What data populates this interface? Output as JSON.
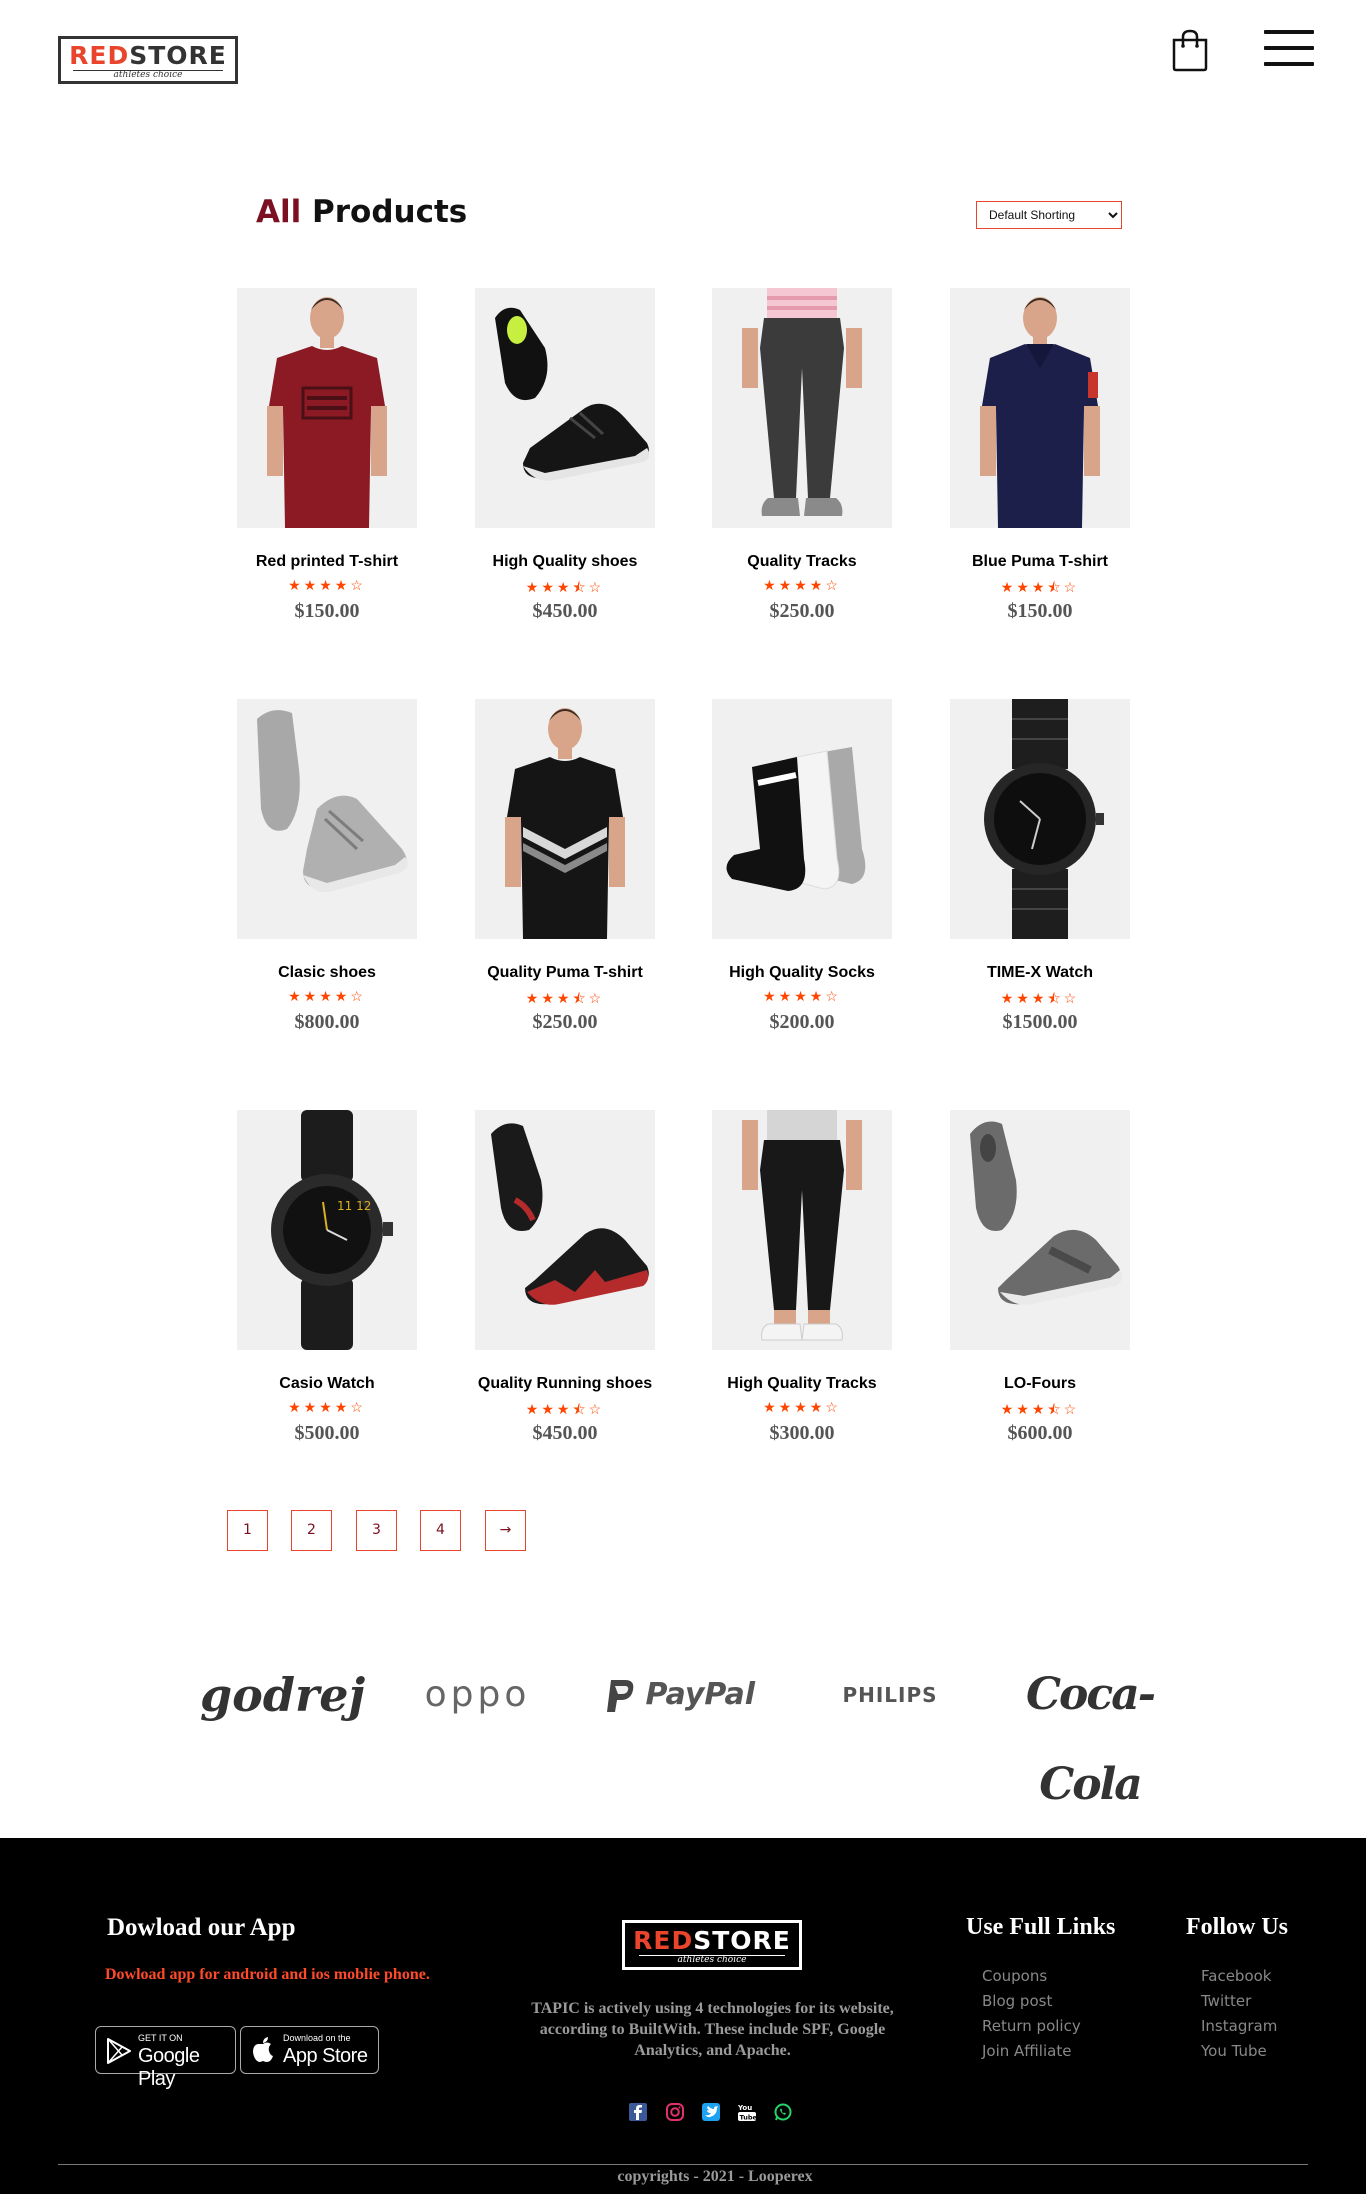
{
  "header": {
    "logo_red": "RED",
    "logo_dark": "STORE",
    "logo_tagline": "athletes choice",
    "cart_icon": "shopping-bag-icon",
    "menu_icon": "hamburger-menu-icon"
  },
  "main": {
    "title_accent": "All",
    "title_rest": " Products",
    "sort_selected": "Default Shorting"
  },
  "products": [
    {
      "name": "Red printed T-shirt",
      "stars": "★★★★☆",
      "price": "$150.00",
      "image": "red-tshirt-image",
      "rating": 4
    },
    {
      "name": "High Quality shoes",
      "stars": "★★★⯪☆",
      "price": "$450.00",
      "image": "black-shoes-image",
      "rating": 3.5
    },
    {
      "name": "Quality Tracks",
      "stars": "★★★★☆",
      "price": "$250.00",
      "image": "grey-tracks-image",
      "rating": 4
    },
    {
      "name": "Blue Puma T-shirt",
      "stars": "★★★⯪☆",
      "price": "$150.00",
      "image": "blue-polo-image",
      "rating": 3.5
    },
    {
      "name": "Clasic shoes",
      "stars": "★★★★☆",
      "price": "$800.00",
      "image": "grey-high-top-shoes-image",
      "rating": 4
    },
    {
      "name": "Quality Puma T-shirt",
      "stars": "★★★⯪☆",
      "price": "$250.00",
      "image": "black-puma-tshirt-image",
      "rating": 3.5
    },
    {
      "name": "High Quality Socks",
      "stars": "★★★★☆",
      "price": "$200.00",
      "image": "socks-image",
      "rating": 4
    },
    {
      "name": "TIME-X Watch",
      "stars": "★★★⯪☆",
      "price": "$1500.00",
      "image": "black-metal-watch-image",
      "rating": 3.5
    },
    {
      "name": "Casio Watch",
      "stars": "★★★★☆",
      "price": "$500.00",
      "image": "black-leather-watch-image",
      "rating": 4
    },
    {
      "name": "Quality Running shoes",
      "stars": "★★★⯪☆",
      "price": "$450.00",
      "image": "running-shoes-image",
      "rating": 3.5
    },
    {
      "name": "High Quality Tracks",
      "stars": "★★★★☆",
      "price": "$300.00",
      "image": "black-joggers-image",
      "rating": 4
    },
    {
      "name": "LO-Fours",
      "stars": "★★★⯪☆",
      "price": "$600.00",
      "image": "grey-slip-on-shoes-image",
      "rating": 3.5
    }
  ],
  "pagination": {
    "pages": [
      "1",
      "2",
      "3",
      "4"
    ],
    "next": "→"
  },
  "brands": [
    "godrej",
    "oppo",
    "PayPal",
    "PHILIPS",
    "Coca-Cola"
  ],
  "footer": {
    "app_title": "Dowload our App",
    "app_text": "Dowload app for android and ios moblie phone.",
    "google_small": "GET IT ON",
    "google_big": "Google Play",
    "apple_small": "Download on the",
    "apple_big": "App Store",
    "logo_red": "RED",
    "logo_white": "STORE",
    "logo_tagline": "athletes choice",
    "description": "TAPIC is actively using 4 technologies for its website, according to BuiltWith. These include SPF, Google Analytics, and Apache.",
    "links_title": "Use Full Links",
    "links": [
      "Coupons",
      "Blog post",
      "Return policy",
      "Join Affiliate"
    ],
    "follow_title": "Follow Us",
    "follow": [
      "Facebook",
      "Twitter",
      "Instagram",
      "You Tube"
    ],
    "social_icons": [
      "facebook-icon",
      "instagram-icon",
      "twitter-icon",
      "youtube-icon",
      "whatsapp-icon"
    ],
    "copyright": "copyrights - 2021 - Looperex"
  },
  "colors": {
    "accent_red": "#e8452c",
    "title_accent": "#7a1020",
    "star": "#ff4500",
    "footer_bg": "#000000"
  }
}
